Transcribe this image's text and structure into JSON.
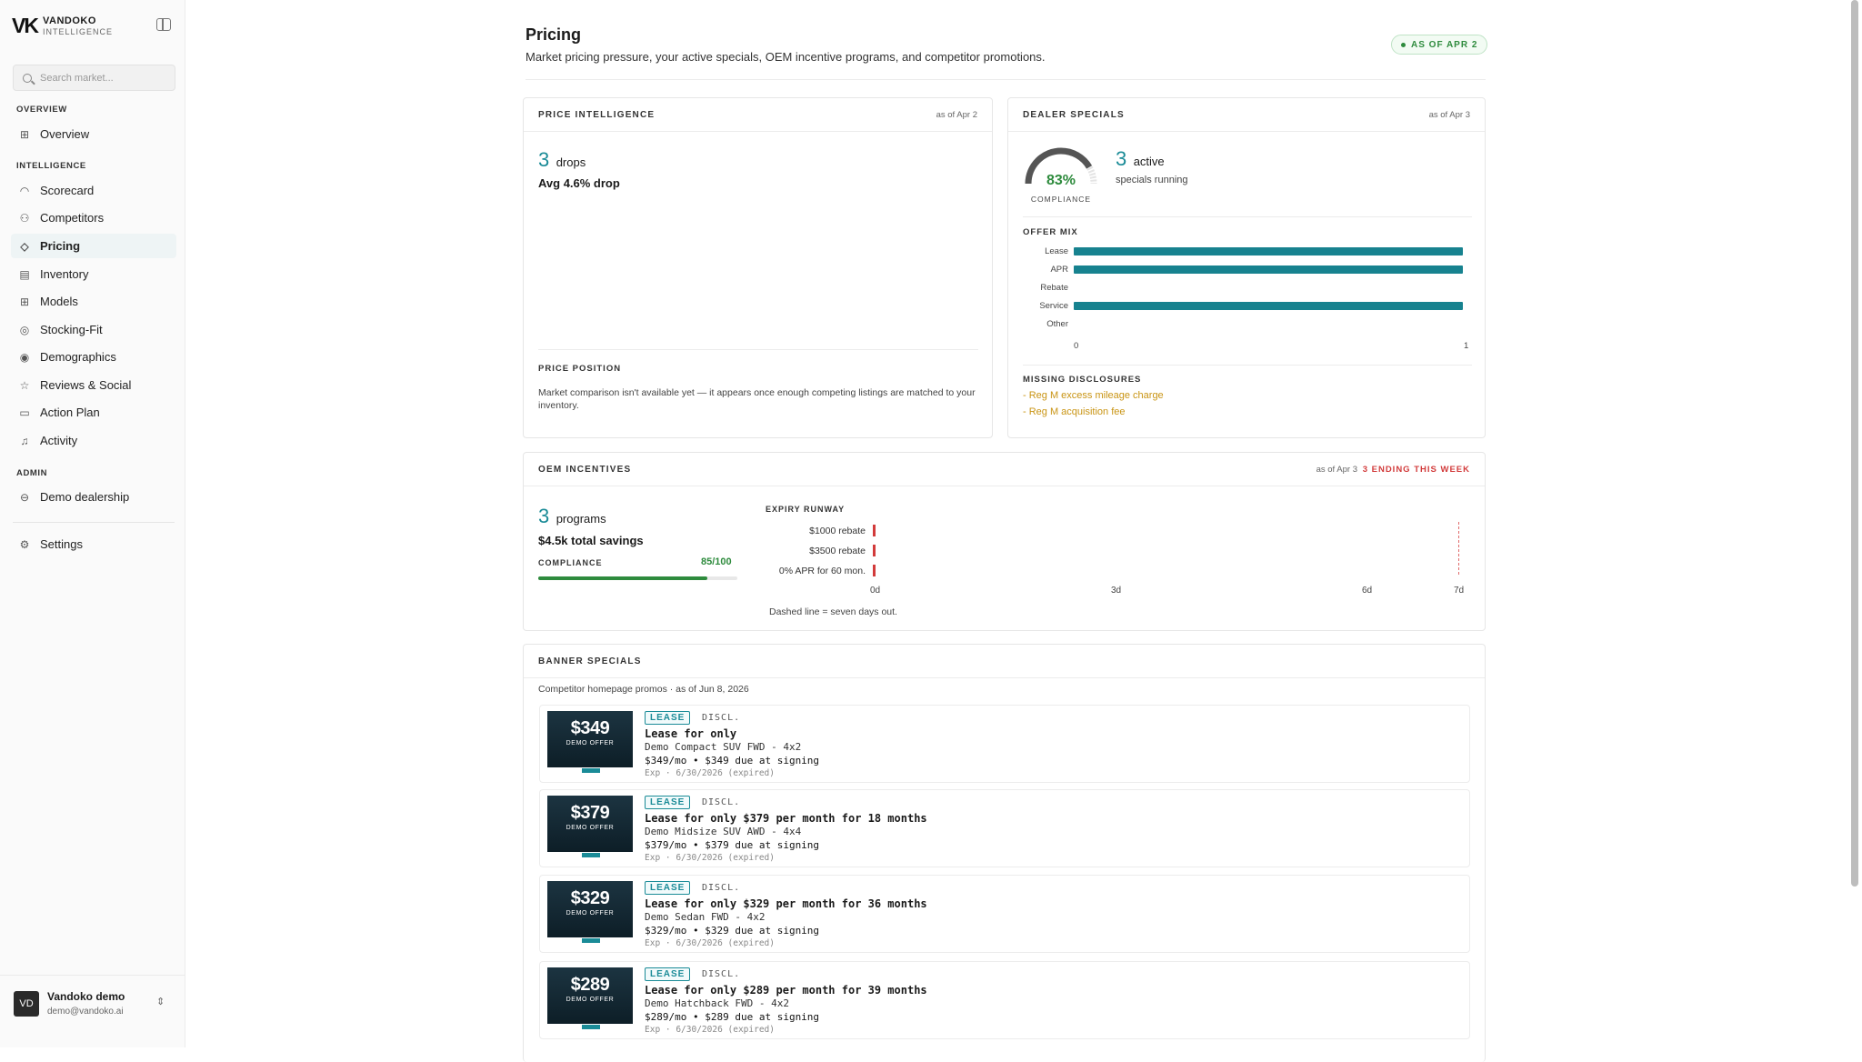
{
  "brand": {
    "mark": "VK",
    "name": "VANDOKO",
    "sub": "INTELLIGENCE"
  },
  "search": {
    "placeholder": "Search market..."
  },
  "nav": {
    "overview_label": "OVERVIEW",
    "intelligence_label": "INTELLIGENCE",
    "admin_label": "ADMIN",
    "items": {
      "overview": "Overview",
      "scorecard": "Scorecard",
      "competitors": "Competitors",
      "pricing": "Pricing",
      "inventory": "Inventory",
      "models": "Models",
      "stocking_fit": "Stocking-Fit",
      "demographics": "Demographics",
      "reviews": "Reviews & Social",
      "action_plan": "Action Plan",
      "activity": "Activity",
      "demo_dealership": "Demo dealership",
      "settings": "Settings"
    }
  },
  "user": {
    "initials": "VD",
    "name": "Vandoko demo",
    "email": "demo@vandoko.ai"
  },
  "page": {
    "title": "Pricing",
    "subtitle": "Market pricing pressure, your active specials, OEM incentive programs, and competitor promotions.",
    "asof_badge": "AS OF APR 2"
  },
  "price_intel": {
    "title": "PRICE INTELLIGENCE",
    "asof": "as of Apr 2",
    "drops_count": "3",
    "drops_label": "drops",
    "avg_drop": "Avg 4.6% drop",
    "position_title": "PRICE POSITION",
    "position_text": "Market comparison isn't available yet — it appears once enough competing listings are matched to your inventory."
  },
  "dealer_specials": {
    "title": "DEALER SPECIALS",
    "asof": "as of Apr 3",
    "compliance_pct": "83%",
    "compliance_value": 83,
    "compliance_label": "COMPLIANCE",
    "active_count": "3",
    "active_label": "active",
    "running_label": "specials running",
    "offer_mix_title": "OFFER MIX",
    "offer_mix": [
      {
        "label": "Lease",
        "value": 1
      },
      {
        "label": "APR",
        "value": 1
      },
      {
        "label": "Rebate",
        "value": 0
      },
      {
        "label": "Service",
        "value": 1
      },
      {
        "label": "Other",
        "value": 0
      }
    ],
    "axis_min": "0",
    "axis_max": "1",
    "missing_title": "MISSING DISCLOSURES",
    "missing": [
      "- Reg M excess mileage charge",
      "- Reg M acquisition fee"
    ]
  },
  "oem": {
    "title": "OEM INCENTIVES",
    "asof": "as of Apr 3",
    "ending": "3 ENDING THIS WEEK",
    "programs_count": "3",
    "programs_label": "programs",
    "savings": "$4.5k total savings",
    "compliance_label": "COMPLIANCE",
    "compliance_score": "85/100",
    "compliance_value": 85,
    "runway_title": "EXPIRY RUNWAY",
    "runway": [
      {
        "label": "$1000 rebate",
        "days": 0
      },
      {
        "label": "$3500 rebate",
        "days": 0
      },
      {
        "label": "0% APR for 60 mon.",
        "days": 0
      }
    ],
    "ticks": [
      "0d",
      "3d",
      "6d",
      "7d"
    ],
    "note": "Dashed line = seven days out."
  },
  "banner": {
    "title": "BANNER SPECIALS",
    "subtitle": "Competitor homepage promos · as of Jun 8, 2026",
    "promos": [
      {
        "thumb_price": "$349",
        "thumb_demo": "DEMO OFFER",
        "badge": "LEASE",
        "discl": "DISCL.",
        "title": "Lease for only",
        "model": "Demo Compact SUV FWD - 4x2",
        "terms": "$349/mo • $349 due at signing",
        "exp": "Exp · 6/30/2026 (expired)"
      },
      {
        "thumb_price": "$379",
        "thumb_demo": "DEMO OFFER",
        "badge": "LEASE",
        "discl": "DISCL.",
        "title": "Lease for only $379 per month for 18 months",
        "model": "Demo Midsize SUV AWD - 4x4",
        "terms": "$379/mo • $379 due at signing",
        "exp": "Exp · 6/30/2026 (expired)"
      },
      {
        "thumb_price": "$329",
        "thumb_demo": "DEMO OFFER",
        "badge": "LEASE",
        "discl": "DISCL.",
        "title": "Lease for only $329 per month for 36 months",
        "model": "Demo Sedan FWD - 4x2",
        "terms": "$329/mo • $329 due at signing",
        "exp": "Exp · 6/30/2026 (expired)"
      },
      {
        "thumb_price": "$289",
        "thumb_demo": "DEMO OFFER",
        "badge": "LEASE",
        "discl": "DISCL.",
        "title": "Lease for only $289 per month for 39 months",
        "model": "Demo Hatchback FWD - 4x2",
        "terms": "$289/mo • $289 due at signing",
        "exp": "Exp · 6/30/2026 (expired)"
      }
    ]
  },
  "colors": {
    "accent": "#1a8b97",
    "bar": "#17828f",
    "success": "#2e8b3d",
    "warning": "#c99413",
    "danger": "#d23b3b"
  }
}
